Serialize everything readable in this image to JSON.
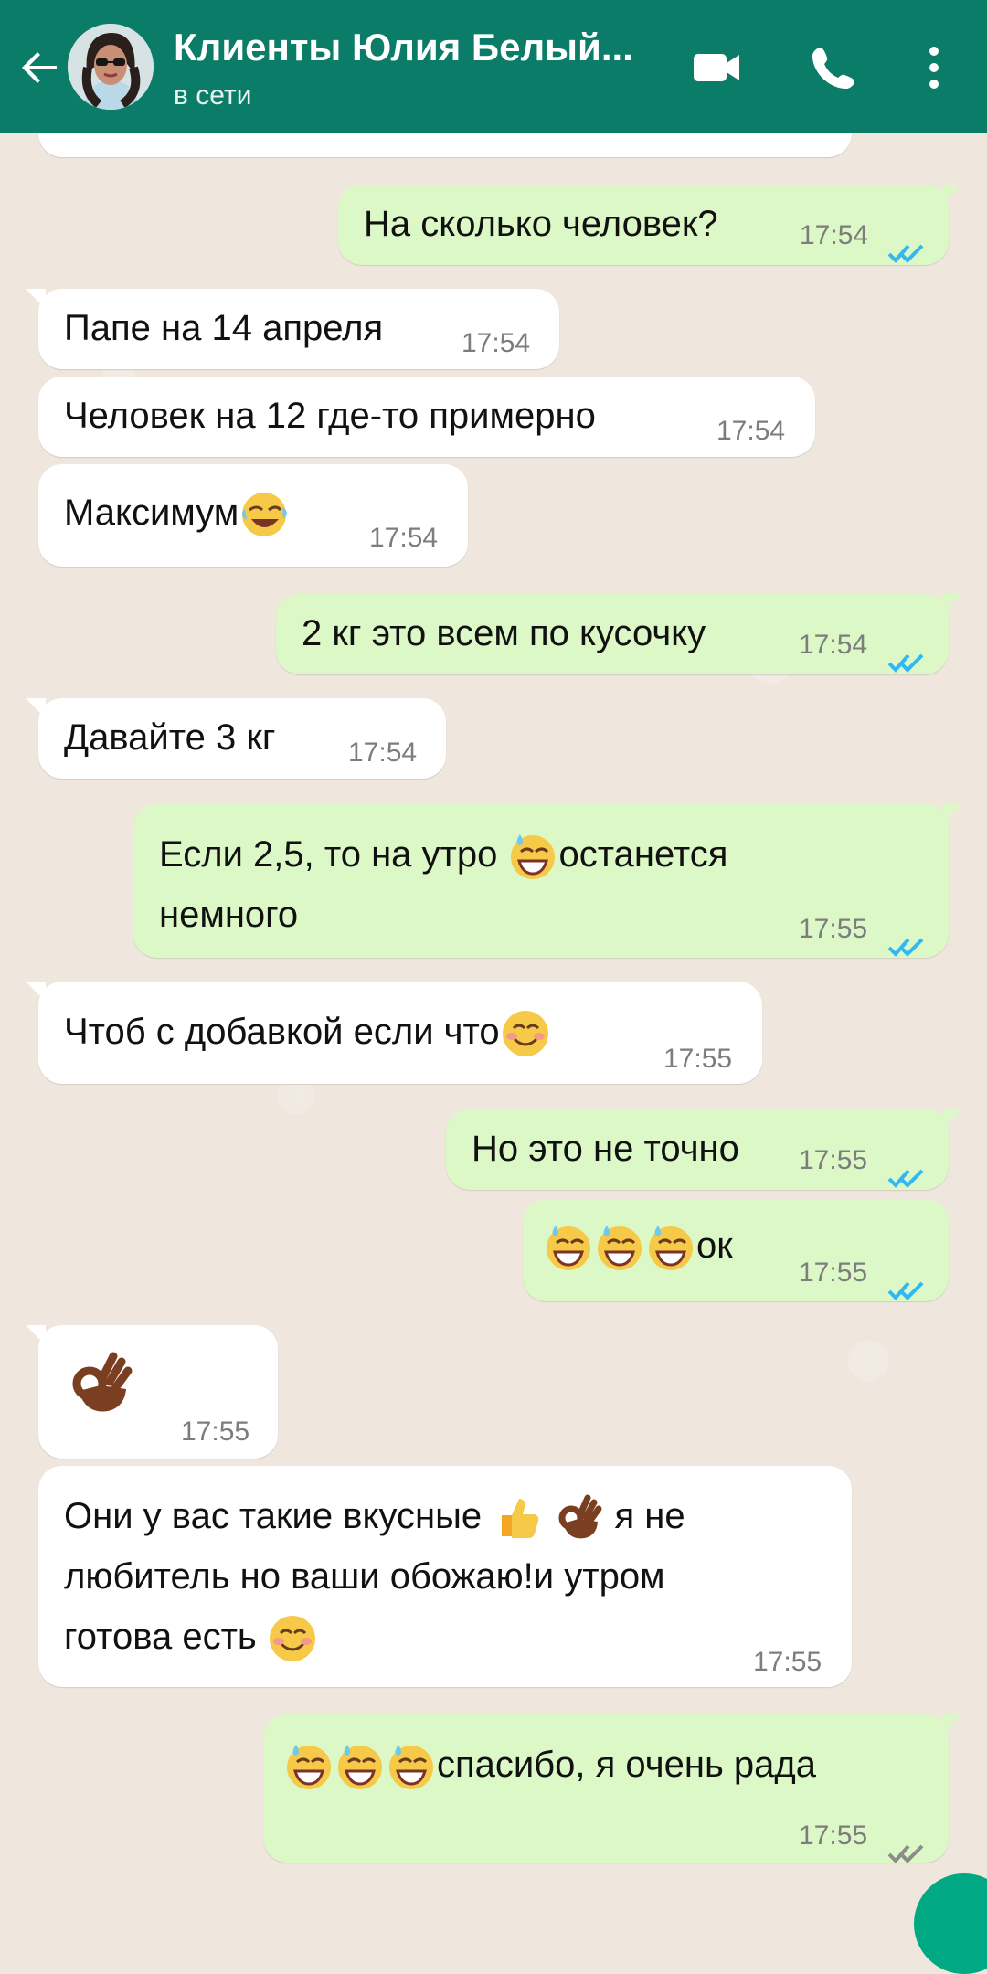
{
  "header": {
    "contact_name": "Клиенты Юлия Белый...",
    "status": "в сети",
    "icons": [
      "back-arrow-icon",
      "video-call-icon",
      "voice-call-icon",
      "more-options-icon"
    ],
    "color": "#0a7c67"
  },
  "colors": {
    "incoming_bubble": "#ffffff",
    "outgoing_bubble": "#dcf8c6",
    "read_ticks": "#34b7f1",
    "sent_ticks": "#8c8c8c",
    "wallpaper": "#efe7de"
  },
  "messages": [
    {
      "direction": "outgoing",
      "text": "На сколько человек?",
      "time": "17:54",
      "status": "read"
    },
    {
      "direction": "incoming",
      "text": "Папе на 14 апреля",
      "time": "17:54"
    },
    {
      "direction": "incoming",
      "text": "Человек на 12 где-то примерно",
      "time": "17:54"
    },
    {
      "direction": "incoming",
      "text": "Максимум",
      "emoji": "rolling-laughing-emoji",
      "time": "17:54"
    },
    {
      "direction": "outgoing",
      "text": "2 кг это всем по кусочку",
      "time": "17:54",
      "status": "read"
    },
    {
      "direction": "incoming",
      "text": "Давайте 3 кг",
      "time": "17:54"
    },
    {
      "direction": "outgoing",
      "text_line1_a": "Если 2,5, то на утро",
      "text_line1_b": "останется",
      "text_line2": "немного",
      "emoji": "grinning-sweat-emoji",
      "time": "17:55",
      "status": "read"
    },
    {
      "direction": "incoming",
      "text": "Чтоб с добавкой если что",
      "emoji": "smiling-blush-emoji",
      "time": "17:55"
    },
    {
      "direction": "outgoing",
      "text": "Но это не точно",
      "time": "17:55",
      "status": "read"
    },
    {
      "direction": "outgoing",
      "text": "ок",
      "emoji": "grinning-sweat-emoji",
      "time": "17:55",
      "status": "read"
    },
    {
      "direction": "incoming",
      "emoji": "ok-hand-emoji",
      "time": "17:55"
    },
    {
      "direction": "incoming",
      "text_line1_a": "Они у вас такие вкусные",
      "text_line1_b": "я не",
      "text_line2": "любитель но ваши обожаю!и утром",
      "text_line3": "готова есть",
      "emoji": "thumbs-up-emoji",
      "time": "17:55"
    },
    {
      "direction": "outgoing",
      "text": "спасибо,  я очень рада",
      "emoji": "grinning-sweat-emoji",
      "time": "17:55",
      "status": "sent"
    }
  ]
}
